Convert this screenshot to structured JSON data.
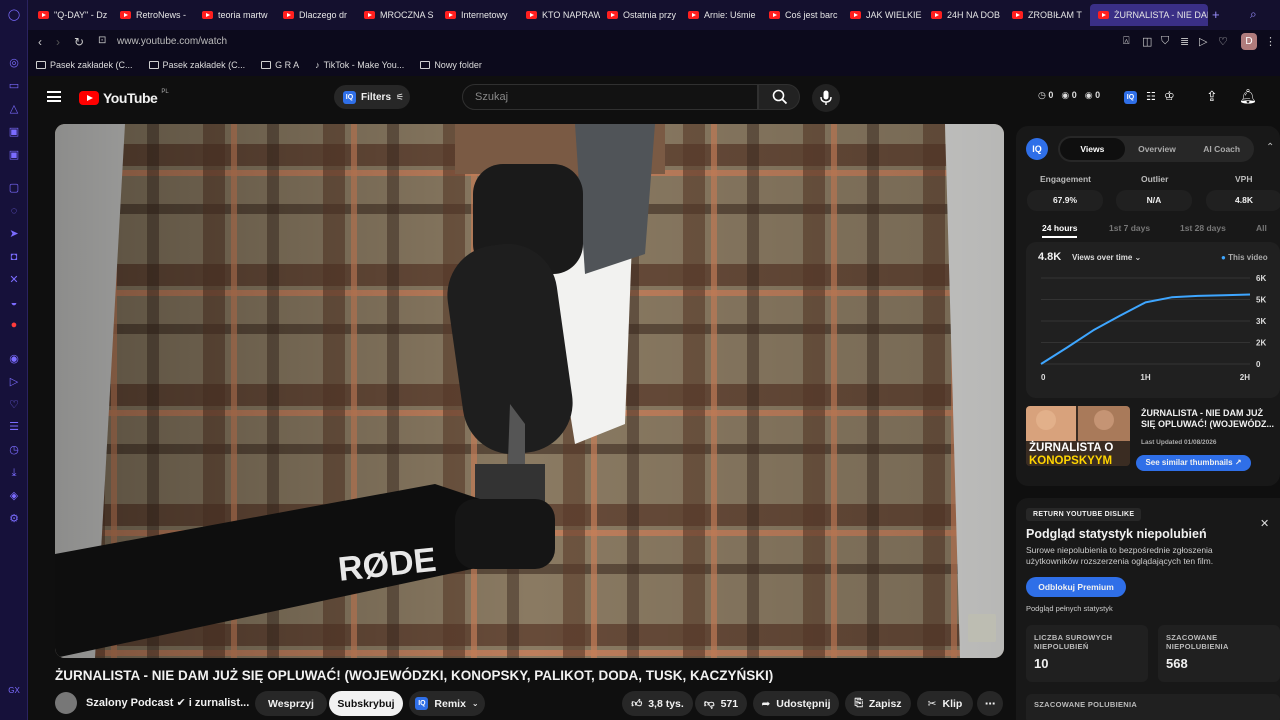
{
  "browser": {
    "tabs": [
      {
        "label": "\"Q-DAY\" - Dz"
      },
      {
        "label": "RetroNews -"
      },
      {
        "label": "teoria martw"
      },
      {
        "label": "Dlaczego dr"
      },
      {
        "label": "MROCZNA S"
      },
      {
        "label": "Internetowy"
      },
      {
        "label": "KTO NAPRAW"
      },
      {
        "label": "Ostatnia przy"
      },
      {
        "label": "Arnie: Uśmie"
      },
      {
        "label": "Coś jest barc"
      },
      {
        "label": "JAK WIELKIE"
      },
      {
        "label": "24H NA DOB"
      },
      {
        "label": "ZROBIŁAM T"
      },
      {
        "label": "ŻURNALISTA - NIE DAM"
      }
    ],
    "url": "www.youtube.com/watch",
    "profile_initial": "D",
    "bookmarks": [
      {
        "label": "Pasek zakładek (C...",
        "icon": "folder-icon"
      },
      {
        "label": "Pasek zakładek (C...",
        "icon": "folder-icon"
      },
      {
        "label": "G R A",
        "icon": "folder-icon"
      },
      {
        "label": "TikTok - Make You...",
        "icon": "tiktok-icon"
      },
      {
        "label": "Nowy folder",
        "icon": "folder-icon"
      }
    ]
  },
  "youtube": {
    "logo_text": "YouTube",
    "country": "PL",
    "filters_label": "Filters",
    "search_placeholder": "Szukaj",
    "header_counts": [
      "0",
      "0",
      "0"
    ]
  },
  "video": {
    "title": "ŻURNALISTA - NIE DAM JUŻ SIĘ OPLUWAĆ! (WOJEWÓDZKI, KONOPSKY, PALIKOT, DODA, TUSK, KACZYŃSKI)",
    "channel": "Szalony Podcast ✔ i zurnalist...",
    "support_label": "Wesprzyj",
    "subscribe_label": "Subskrybuj",
    "remix_label": "Remix",
    "likes": "3,8 tys.",
    "dislikes": "571",
    "share_label": "Udostępnij",
    "save_label": "Zapisz",
    "clip_label": "Klip",
    "mic_brand": "RØDE"
  },
  "iq_panel": {
    "tabs": [
      "Views",
      "Overview",
      "AI Coach"
    ],
    "active_tab": "Views",
    "metrics": [
      {
        "label": "Engagement",
        "value": "67.9%"
      },
      {
        "label": "Outlier",
        "value": "N/A"
      },
      {
        "label": "VPH",
        "value": "4.8K"
      }
    ],
    "ranges": [
      "24 hours",
      "1st 7 days",
      "1st 28 days",
      "All"
    ],
    "active_range": "24 hours",
    "total_views": "4.8K",
    "chart_selector": "Views over time",
    "legend": "This video",
    "similar_title": "ŻURNALISTA - NIE DAM JUŻ SIĘ OPLUWAĆ! (WOJEWÓDZ...",
    "similar_updated": "Last Updated 01/08/2026",
    "similar_button": "See similar thumbnails ↗",
    "thumb_text_1": "ŻURNALISTA O",
    "thumb_text_2": "KONOPSKYYM",
    "accent": "#2f6fe8"
  },
  "chart_data": {
    "type": "line",
    "title": "Views over time",
    "x_ticks": [
      "0",
      "1H",
      "2H"
    ],
    "y_ticks": [
      "6K",
      "5K",
      "3K",
      "2K",
      "0"
    ],
    "series": [
      {
        "name": "This video",
        "x": [
          0,
          0.25,
          0.5,
          0.75,
          1.0,
          1.25,
          1.5,
          1.75,
          2.0
        ],
        "values": [
          0,
          1150,
          2350,
          3350,
          4300,
          4650,
          4750,
          4800,
          4850
        ],
        "color": "#3ea6ff"
      }
    ],
    "ylim": [
      0,
      6000
    ],
    "xlim": [
      0,
      2
    ]
  },
  "ryd_panel": {
    "badge": "RETURN YOUTUBE DISLIKE",
    "heading": "Podgląd statystyk niepolubień",
    "description": "Surowe niepolubienia to bezpośrednie zgłoszenia użytkowników rozszerzenia oglądających ten film.",
    "button": "Odblokuj Premium",
    "small_text": "Podgląd pełnych statystyk",
    "cards": [
      {
        "label": "LICZBA SUROWYCH NIEPOLUBIEŃ",
        "value": "10"
      },
      {
        "label": "SZACOWANE NIEPOLUBIENIA",
        "value": "568"
      }
    ],
    "likes_label": "SZACOWANE POLUBIENIA"
  }
}
